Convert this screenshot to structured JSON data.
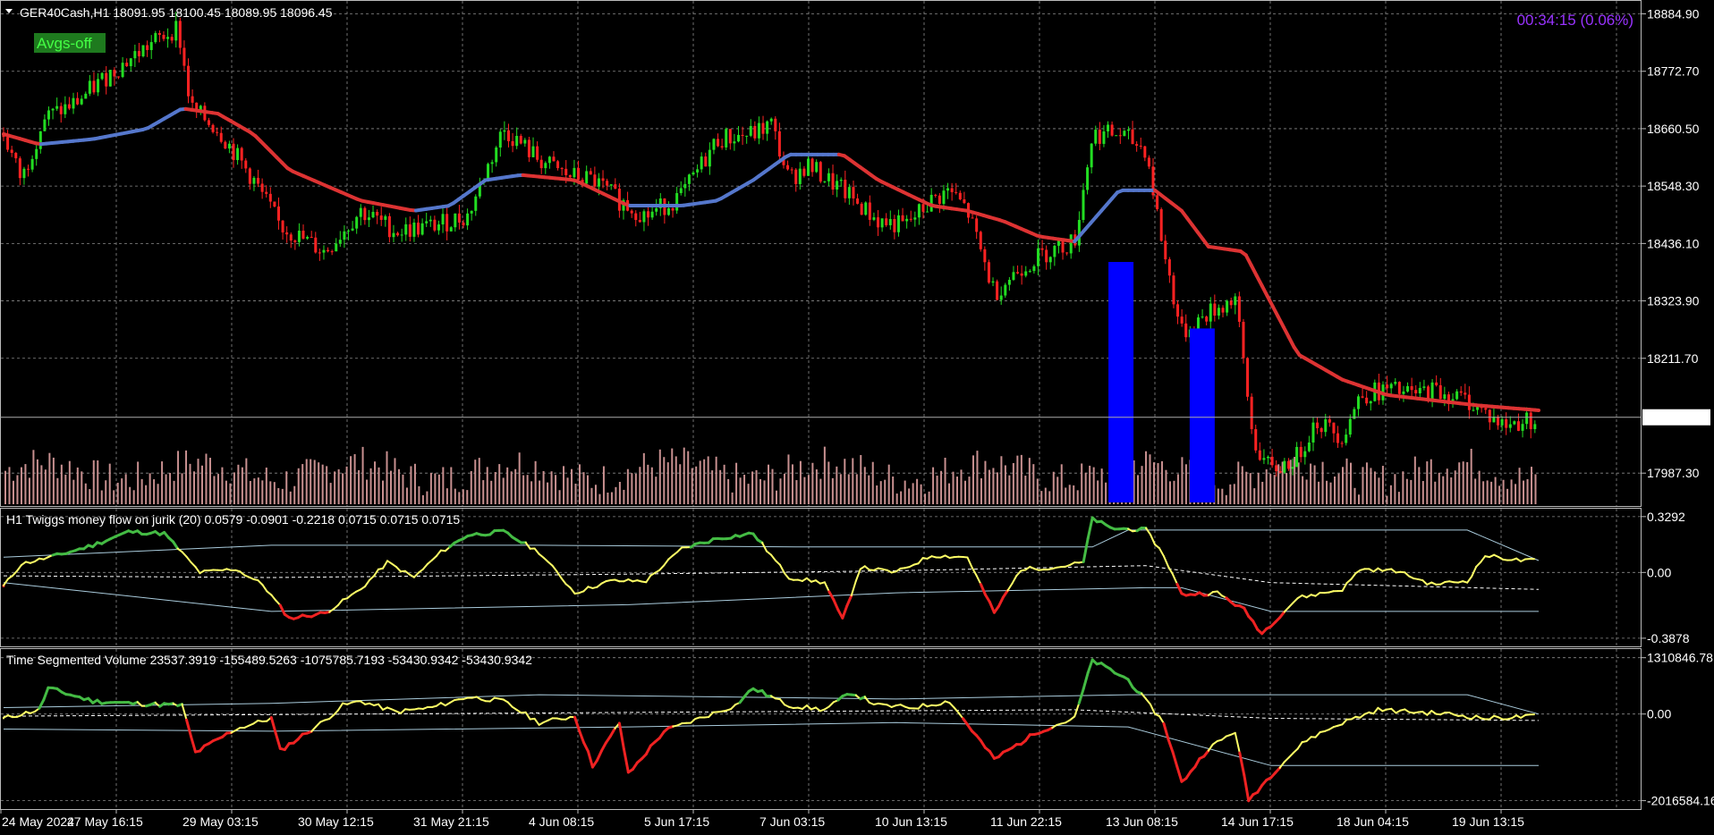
{
  "symbol_header": "GER40Cash,H1  18091.95 18100.45 18089.95 18096.45",
  "avgs_button": "Avgs-off",
  "timer": "00:34:15 (0.06%)",
  "current_price": "18096.45",
  "colors": {
    "background": "#000000",
    "grid": "#8a8a8a",
    "bull": "#22dd22",
    "bear": "#ff2222",
    "ma_up": "#5577cc",
    "ma_down": "#dd3333",
    "volume": "#c89090",
    "blue_bar": "#0000ff",
    "yellow": "#ffff66",
    "green": "#44bb44",
    "red": "#ee2222",
    "band": "#aaccdd",
    "timer": "#9933ff",
    "button_bg": "#1e7a1e",
    "button_text": "#33ff33"
  },
  "chart_data": [
    {
      "type": "candlestick",
      "title": "GER40Cash,H1  18091.95 18100.45 18089.95 18096.45",
      "ylim": [
        17930,
        18905
      ],
      "y_ticks": [
        "18884.90",
        "18772.70",
        "18660.50",
        "18548.30",
        "18436.10",
        "18323.90",
        "18211.70",
        "17987.30"
      ],
      "x_ticks": [
        "24 May 2024",
        "27 May 16:15",
        "29 May 03:15",
        "30 May 12:15",
        "31 May 21:15",
        "4 Jun 08:15",
        "5 Jun 17:15",
        "7 Jun 03:15",
        "10 Jun 13:15",
        "11 Jun 22:15",
        "13 Jun 08:15",
        "14 Jun 17:15",
        "18 Jun 04:15",
        "19 Jun 13:15"
      ],
      "price_path": [
        [
          0,
          18650
        ],
        [
          20,
          18560
        ],
        [
          45,
          18680
        ],
        [
          80,
          18710
        ],
        [
          120,
          18770
        ],
        [
          160,
          18820
        ],
        [
          195,
          18860
        ],
        [
          210,
          18700
        ],
        [
          240,
          18660
        ],
        [
          280,
          18560
        ],
        [
          310,
          18470
        ],
        [
          360,
          18420
        ],
        [
          400,
          18500
        ],
        [
          440,
          18460
        ],
        [
          480,
          18470
        ],
        [
          520,
          18490
        ],
        [
          560,
          18660
        ],
        [
          600,
          18600
        ],
        [
          630,
          18570
        ],
        [
          660,
          18560
        ],
        [
          690,
          18520
        ],
        [
          720,
          18490
        ],
        [
          760,
          18530
        ],
        [
          800,
          18640
        ],
        [
          840,
          18650
        ],
        [
          860,
          18670
        ],
        [
          880,
          18560
        ],
        [
          900,
          18590
        ],
        [
          940,
          18540
        ],
        [
          980,
          18480
        ],
        [
          1010,
          18470
        ],
        [
          1040,
          18520
        ],
        [
          1060,
          18540
        ],
        [
          1080,
          18500
        ],
        [
          1110,
          18340
        ],
        [
          1140,
          18390
        ],
        [
          1170,
          18420
        ],
        [
          1200,
          18440
        ],
        [
          1220,
          18650
        ],
        [
          1250,
          18650
        ],
        [
          1280,
          18620
        ],
        [
          1300,
          18420
        ],
        [
          1320,
          18260
        ],
        [
          1350,
          18300
        ],
        [
          1380,
          18330
        ],
        [
          1400,
          18050
        ],
        [
          1420,
          17990
        ],
        [
          1450,
          18020
        ],
        [
          1470,
          18090
        ],
        [
          1500,
          18060
        ],
        [
          1520,
          18140
        ],
        [
          1550,
          18150
        ],
        [
          1580,
          18140
        ],
        [
          1600,
          18150
        ],
        [
          1640,
          18130
        ],
        [
          1680,
          18080
        ],
        [
          1720,
          18096
        ]
      ],
      "ma_path": [
        [
          0,
          18650
        ],
        [
          40,
          18630
        ],
        [
          100,
          18640
        ],
        [
          160,
          18660
        ],
        [
          200,
          18700
        ],
        [
          240,
          18690
        ],
        [
          280,
          18650
        ],
        [
          320,
          18580
        ],
        [
          360,
          18550
        ],
        [
          400,
          18520
        ],
        [
          460,
          18500
        ],
        [
          500,
          18510
        ],
        [
          540,
          18560
        ],
        [
          580,
          18570
        ],
        [
          640,
          18560
        ],
        [
          700,
          18510
        ],
        [
          760,
          18510
        ],
        [
          800,
          18520
        ],
        [
          840,
          18560
        ],
        [
          880,
          18610
        ],
        [
          940,
          18610
        ],
        [
          980,
          18560
        ],
        [
          1040,
          18510
        ],
        [
          1080,
          18500
        ],
        [
          1120,
          18480
        ],
        [
          1160,
          18450
        ],
        [
          1200,
          18440
        ],
        [
          1230,
          18500
        ],
        [
          1250,
          18540
        ],
        [
          1290,
          18540
        ],
        [
          1320,
          18500
        ],
        [
          1350,
          18430
        ],
        [
          1390,
          18420
        ],
        [
          1420,
          18320
        ],
        [
          1450,
          18220
        ],
        [
          1500,
          18170
        ],
        [
          1550,
          18140
        ],
        [
          1600,
          18130
        ],
        [
          1650,
          18120
        ],
        [
          1720,
          18110
        ]
      ],
      "volume_bars": [
        {
          "x": 1252,
          "top": 18400
        },
        {
          "x": 1343,
          "top": 18270
        }
      ]
    },
    {
      "type": "line",
      "title": "H1 Twiggs money flow on jurik (20) 0.0579 -0.0901 -0.2218 0.0715 0.0715 0.0715",
      "ylim": [
        -0.42,
        0.36
      ],
      "y_ticks": [
        "0.3292",
        "0.00",
        "-0.3878"
      ],
      "series_path": [
        [
          0,
          -0.08
        ],
        [
          20,
          0.05
        ],
        [
          60,
          0.1
        ],
        [
          100,
          0.16
        ],
        [
          140,
          0.24
        ],
        [
          180,
          0.23
        ],
        [
          220,
          0.0
        ],
        [
          260,
          0.02
        ],
        [
          290,
          -0.07
        ],
        [
          320,
          -0.27
        ],
        [
          360,
          -0.24
        ],
        [
          400,
          -0.1
        ],
        [
          430,
          0.06
        ],
        [
          460,
          -0.03
        ],
        [
          490,
          0.12
        ],
        [
          520,
          0.22
        ],
        [
          560,
          0.24
        ],
        [
          600,
          0.12
        ],
        [
          640,
          -0.12
        ],
        [
          680,
          -0.05
        ],
        [
          720,
          -0.05
        ],
        [
          760,
          0.14
        ],
        [
          800,
          0.2
        ],
        [
          840,
          0.23
        ],
        [
          880,
          -0.03
        ],
        [
          920,
          -0.06
        ],
        [
          940,
          -0.28
        ],
        [
          960,
          0.03
        ],
        [
          1000,
          0.0
        ],
        [
          1040,
          0.1
        ],
        [
          1080,
          0.09
        ],
        [
          1110,
          -0.24
        ],
        [
          1140,
          0.02
        ],
        [
          1180,
          0.03
        ],
        [
          1210,
          0.06
        ],
        [
          1220,
          0.32
        ],
        [
          1240,
          0.26
        ],
        [
          1280,
          0.25
        ],
        [
          1300,
          0.1
        ],
        [
          1320,
          -0.13
        ],
        [
          1360,
          -0.12
        ],
        [
          1390,
          -0.22
        ],
        [
          1410,
          -0.36
        ],
        [
          1450,
          -0.15
        ],
        [
          1500,
          -0.1
        ],
        [
          1520,
          0.02
        ],
        [
          1560,
          0.01
        ],
        [
          1600,
          -0.07
        ],
        [
          1640,
          -0.05
        ],
        [
          1660,
          0.1
        ],
        [
          1700,
          0.07
        ],
        [
          1720,
          0.07
        ]
      ],
      "upper_band_path": [
        [
          0,
          0.09
        ],
        [
          300,
          0.16
        ],
        [
          600,
          0.16
        ],
        [
          900,
          0.15
        ],
        [
          1220,
          0.15
        ],
        [
          1260,
          0.25
        ],
        [
          1640,
          0.25
        ],
        [
          1720,
          0.07
        ]
      ],
      "lower_band_path": [
        [
          0,
          -0.06
        ],
        [
          300,
          -0.23
        ],
        [
          700,
          -0.19
        ],
        [
          1000,
          -0.12
        ],
        [
          1280,
          -0.09
        ],
        [
          1320,
          -0.09
        ],
        [
          1420,
          -0.23
        ],
        [
          1720,
          -0.23
        ]
      ],
      "mid_band_path": [
        [
          0,
          -0.02
        ],
        [
          300,
          -0.03
        ],
        [
          700,
          -0.01
        ],
        [
          1000,
          0.01
        ],
        [
          1280,
          0.04
        ],
        [
          1420,
          -0.06
        ],
        [
          1720,
          -0.1
        ]
      ]
    },
    {
      "type": "line",
      "title": "Time Segmented Volume 23537.3919 -155489.5263 -1075785.7193 -53430.9342 -53430.9342",
      "ylim": [
        -2150000,
        1450000
      ],
      "y_ticks": [
        "1310846.78",
        "0.00",
        "-2016584.16"
      ],
      "series_path": [
        [
          0,
          -100000.0
        ],
        [
          40,
          100000.0
        ],
        [
          50,
          600000.0
        ],
        [
          100,
          300000.0
        ],
        [
          140,
          250000.0
        ],
        [
          200,
          200000.0
        ],
        [
          215,
          -900000.0
        ],
        [
          260,
          -350000.0
        ],
        [
          300,
          -100000.0
        ],
        [
          310,
          -850000.0
        ],
        [
          360,
          -150000.0
        ],
        [
          380,
          200000.0
        ],
        [
          400,
          300000.0
        ],
        [
          440,
          50000.0
        ],
        [
          480,
          150000.0
        ],
        [
          520,
          400000.0
        ],
        [
          560,
          300000.0
        ],
        [
          600,
          -200000.0
        ],
        [
          640,
          -50000.0
        ],
        [
          660,
          -1200000.0
        ],
        [
          690,
          -200000.0
        ],
        [
          700,
          -1400000.0
        ],
        [
          740,
          -400000.0
        ],
        [
          780,
          -100000.0
        ],
        [
          820,
          200000.0
        ],
        [
          840,
          600000.0
        ],
        [
          880,
          200000.0
        ],
        [
          920,
          100000.0
        ],
        [
          950,
          500000.0
        ],
        [
          980,
          200000.0
        ],
        [
          1020,
          150000.0
        ],
        [
          1060,
          300000.0
        ],
        [
          1110,
          -1050000.0
        ],
        [
          1160,
          -400000.0
        ],
        [
          1200,
          -100000.0
        ],
        [
          1220,
          1250000.0
        ],
        [
          1260,
          800000.0
        ],
        [
          1300,
          -200000.0
        ],
        [
          1320,
          -1600000.0
        ],
        [
          1350,
          -800000.0
        ],
        [
          1380,
          -400000.0
        ],
        [
          1395,
          -2000000.0
        ],
        [
          1430,
          -1200000.0
        ],
        [
          1460,
          -600000.0
        ],
        [
          1500,
          -200000.0
        ],
        [
          1540,
          100000.0
        ],
        [
          1580,
          50000.0
        ],
        [
          1620,
          0.0
        ],
        [
          1660,
          -100000.0
        ],
        [
          1720,
          -50000.0
        ]
      ],
      "upper_band_path": [
        [
          0,
          150000.0
        ],
        [
          300,
          250000.0
        ],
        [
          600,
          450000.0
        ],
        [
          1000,
          350000.0
        ],
        [
          1260,
          450000.0
        ],
        [
          1640,
          450000.0
        ],
        [
          1720,
          0.0
        ]
      ],
      "lower_band_path": [
        [
          0,
          -350000.0
        ],
        [
          300,
          -400000.0
        ],
        [
          700,
          -300000.0
        ],
        [
          1000,
          -200000.0
        ],
        [
          1260,
          -300000.0
        ],
        [
          1420,
          -1200000.0
        ],
        [
          1720,
          -1200000.0
        ]
      ],
      "mid_band_path": [
        [
          0,
          -50000.0
        ],
        [
          400,
          0.0
        ],
        [
          800,
          50000.0
        ],
        [
          1200,
          100000.0
        ],
        [
          1420,
          -100000.0
        ],
        [
          1720,
          -150000.0
        ]
      ]
    }
  ]
}
